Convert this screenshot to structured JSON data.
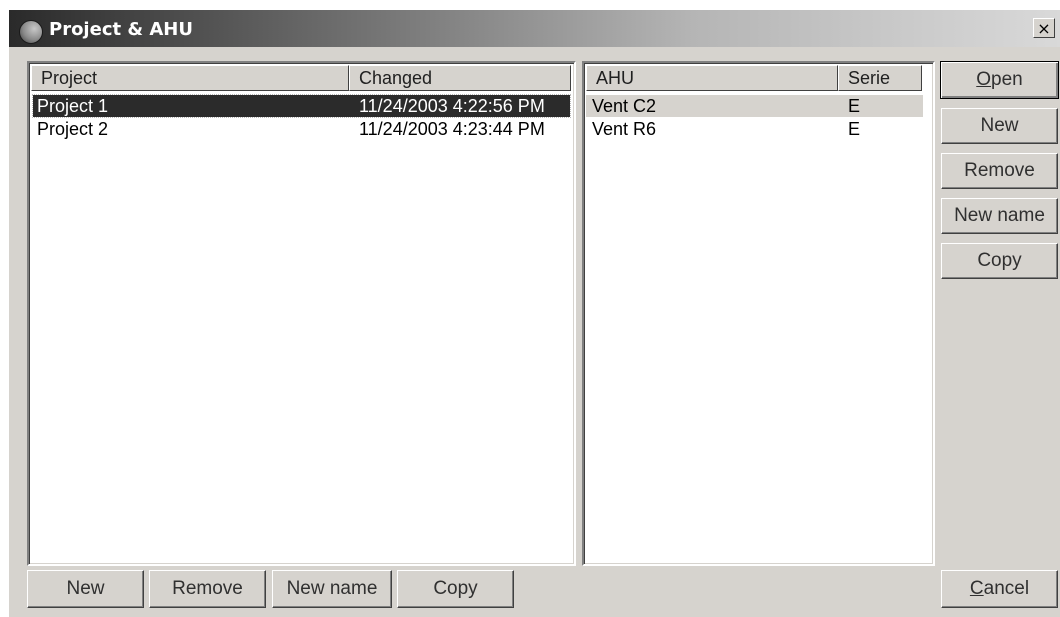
{
  "window": {
    "title": "Project & AHU",
    "close_glyph": "×"
  },
  "project_list": {
    "columns": [
      "Project",
      "Changed"
    ],
    "rows": [
      {
        "project": "Project 1",
        "changed": "11/24/2003 4:22:56 PM",
        "selected": true
      },
      {
        "project": "Project 2",
        "changed": "11/24/2003 4:23:44 PM",
        "selected": false
      }
    ],
    "buttons": {
      "new": "New",
      "remove": "Remove",
      "new_name": "New name",
      "copy": "Copy"
    }
  },
  "ahu_list": {
    "columns": [
      "AHU",
      "Serie"
    ],
    "rows": [
      {
        "ahu": "Vent C2",
        "serie": "E",
        "selected": true
      },
      {
        "ahu": "Vent R6",
        "serie": "E",
        "selected": false
      }
    ]
  },
  "side_buttons": {
    "open_first": "O",
    "open_rest": "pen",
    "new": "New",
    "remove": "Remove",
    "new_name": "New name",
    "copy": "Copy",
    "cancel_first": "C",
    "cancel_rest": "ancel"
  },
  "icons": {
    "app": "app-logo-icon",
    "close": "close-icon"
  }
}
